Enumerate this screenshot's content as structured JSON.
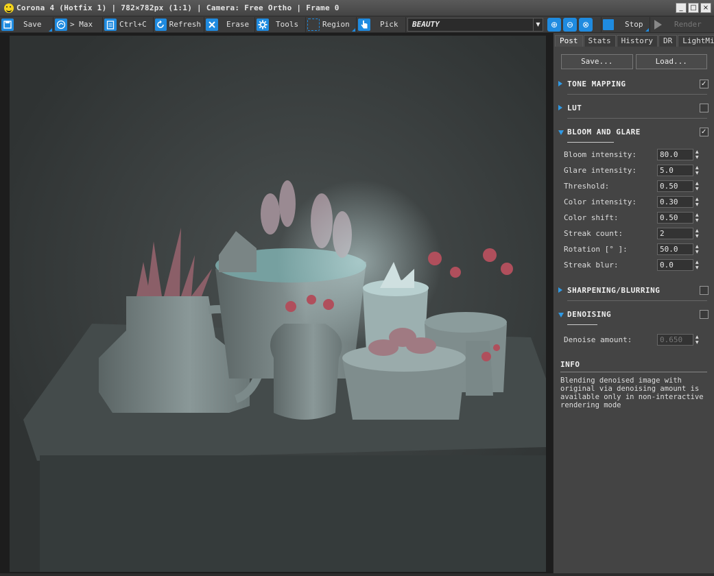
{
  "window": {
    "title": "Corona 4 (Hotfix 1) | 782×782px (1:1) | Camera: Free Ortho | Frame 0",
    "controls": [
      "_",
      "□",
      "×"
    ]
  },
  "toolbar": {
    "save": "Save",
    "max": "> Max",
    "copy": "Ctrl+C",
    "refresh": "Refresh",
    "erase": "Erase",
    "tools": "Tools",
    "region": "Region",
    "pick": "Pick",
    "render_pass": "BEAUTY",
    "stop": "Stop",
    "render": "Render"
  },
  "icons": {
    "save": "floppy-disk-icon",
    "max": "3dsmax-icon",
    "copy": "clipboard-icon",
    "refresh": "refresh-icon",
    "erase": "erase-icon",
    "tools": "gear-icon",
    "region": "region-select-icon",
    "pick": "hand-pointer-icon",
    "zoom_in": "zoom-in-icon",
    "zoom_out": "zoom-out-icon",
    "zoom_fit": "zoom-fit-icon",
    "stop": "stop-icon",
    "render": "play-icon"
  },
  "colors": {
    "accent": "#1f8be0",
    "panel_bg": "#444444",
    "viewport_bg": "#1d1d1d"
  },
  "tabs": [
    "Post",
    "Stats",
    "History",
    "DR",
    "LightMix"
  ],
  "active_tab": "Post",
  "panel": {
    "save_label": "Save...",
    "load_label": "Load...",
    "sections": {
      "tone_mapping": {
        "label": "TONE MAPPING",
        "enabled": true
      },
      "lut": {
        "label": "LUT",
        "enabled": false
      },
      "bloom_glare": {
        "label": "BLOOM AND GLARE",
        "enabled": true
      },
      "sharpening": {
        "label": "SHARPENING/BLURRING",
        "enabled": false
      },
      "denoising": {
        "label": "DENOISING",
        "enabled": false
      }
    },
    "bloom_params": [
      {
        "label": "Bloom intensity:",
        "value": "80.0"
      },
      {
        "label": "Glare intensity:",
        "value": "5.0"
      },
      {
        "label": "Threshold:",
        "value": "0.50"
      },
      {
        "label": "Color intensity:",
        "value": "0.30"
      },
      {
        "label": "Color shift:",
        "value": "0.50"
      },
      {
        "label": "Streak count:",
        "value": "2"
      },
      {
        "label": "Rotation [° ]:",
        "value": "50.0"
      },
      {
        "label": "Streak blur:",
        "value": "0.0"
      }
    ],
    "denoise": {
      "label": "Denoise amount:",
      "value": "0.650"
    },
    "info": {
      "title": "INFO",
      "text": "Blending denoised image with original via denoising amount is available only in non-interactive rendering mode"
    }
  }
}
